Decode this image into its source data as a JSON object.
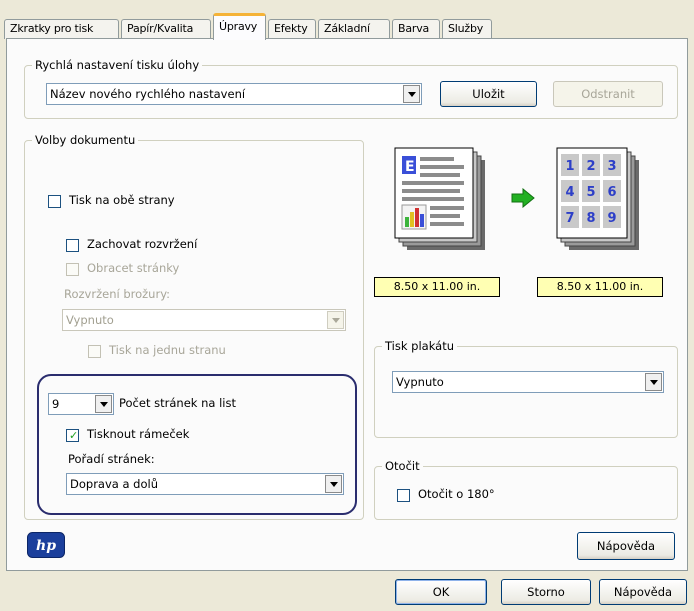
{
  "tabs": [
    {
      "label": "Zkratky pro tisk"
    },
    {
      "label": "Papír/Kvalita"
    },
    {
      "label": "Úpravy"
    },
    {
      "label": "Efekty"
    },
    {
      "label": "Základní"
    },
    {
      "label": "Barva"
    },
    {
      "label": "Služby"
    }
  ],
  "active_tab": "Úpravy",
  "quick_settings": {
    "legend": "Rychlá nastavení tisku úlohy",
    "name_value": "Název nového rychlého nastavení",
    "save_label": "Uložit",
    "delete_label": "Odstranit"
  },
  "document_options": {
    "legend": "Volby dokumentu",
    "duplex_label": "Tisk na obě strany",
    "keep_layout_label": "Zachovat rozvržení",
    "flip_pages_label": "Obracet stránky",
    "booklet_layout_label": "Rozvržení brožury:",
    "booklet_layout_value": "Vypnuto",
    "print_one_side_label": "Tisk na jednu stranu",
    "pages_per_sheet_value": "9",
    "pages_per_sheet_label": "Počet stránek na list",
    "print_border_label": "Tisknout rámeček",
    "page_order_label": "Pořadí stránek:",
    "page_order_value": "Doprava a dolů"
  },
  "preview": {
    "source_size": "8.50 x 11.00 in.",
    "target_size": "8.50 x 11.00 in.",
    "grid_numbers": [
      "1",
      "2",
      "3",
      "4",
      "5",
      "6",
      "7",
      "8",
      "9"
    ]
  },
  "poster": {
    "legend": "Tisk plakátu",
    "value": "Vypnuto"
  },
  "rotate": {
    "legend": "Otočit",
    "rotate_label": "Otočit o 180°"
  },
  "panel_help_label": "Nápověda",
  "footer": {
    "ok_label": "OK",
    "cancel_label": "Storno",
    "help_label": "Nápověda"
  },
  "logo_text": "hp",
  "icons": {
    "arrow": "green-right-arrow-icon",
    "logo": "hp-logo-icon"
  },
  "colors": {
    "active_tab_accent": "#f5b337",
    "size_label_bg": "#ffffb3",
    "highlight_ring": "#2a2d6e",
    "checkmark": "#21a121",
    "arrow": "#22b022"
  }
}
